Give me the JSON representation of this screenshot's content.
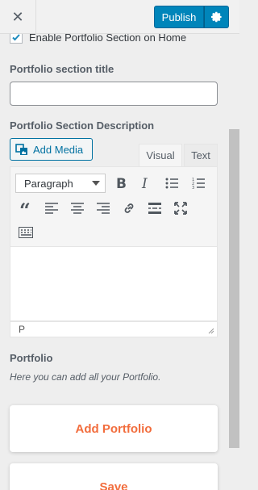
{
  "header": {
    "close_icon": "close-icon",
    "publish_label": "Publish",
    "gear_icon": "gear-icon"
  },
  "section": {
    "enable_checkbox_label": "Enable Portfolio Section on Home",
    "enable_checked": true,
    "title_label": "Portfolio section title",
    "title_value": "",
    "description_label": "Portfolio Section Description"
  },
  "editor": {
    "add_media_label": "Add Media",
    "tabs": [
      "Visual",
      "Text"
    ],
    "active_tab": "Visual",
    "format_value": "Paragraph",
    "toolbar_icons": [
      "bold-icon",
      "italic-icon",
      "bullet-list-icon",
      "numbered-list-icon",
      "blockquote-icon",
      "align-left-icon",
      "align-center-icon",
      "align-right-icon",
      "link-icon",
      "read-more-icon",
      "fullscreen-icon",
      "toolbar-toggle-icon"
    ],
    "content": "",
    "path": "P"
  },
  "portfolio": {
    "label": "Portfolio",
    "description": "Here you can add all your Portfolio.",
    "add_button_label": "Add Portfolio",
    "save_button_label": "Save"
  },
  "colors": {
    "primary": "#0085ba",
    "accent": "#f26d3d",
    "link": "#0071a1"
  }
}
